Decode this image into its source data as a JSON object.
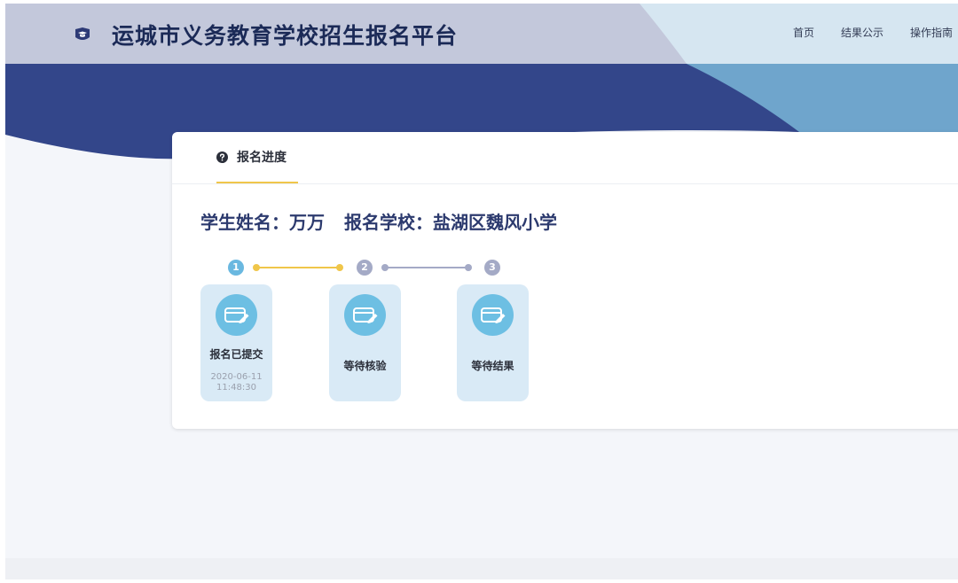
{
  "header": {
    "title": "运城市义务教育学校招生报名平台",
    "nav": [
      "首页",
      "结果公示",
      "操作指南"
    ]
  },
  "card": {
    "tab_label": "报名进度",
    "student_label": "学生姓名：",
    "student_name": "万万",
    "school_label": "报名学校：",
    "school_name": "盐湖区魏风小学"
  },
  "steps": [
    {
      "number": "1",
      "label": "报名已提交",
      "date": "2020-06-11",
      "time": "11:48:30",
      "status": "done"
    },
    {
      "number": "2",
      "label": "等待核验",
      "status": "pending"
    },
    {
      "number": "3",
      "label": "等待结果",
      "status": "pending"
    }
  ],
  "colors": {
    "brand_dark": "#33468a",
    "accent_yellow": "#f0c64a",
    "step_active": "#6ab8e0",
    "step_inactive": "#a4aac6",
    "step_card_bg": "#d9eaf6"
  },
  "icons": {
    "header": "graduation-cap-icon",
    "tab": "question-circle-icon",
    "step": "card-edit-icon"
  }
}
